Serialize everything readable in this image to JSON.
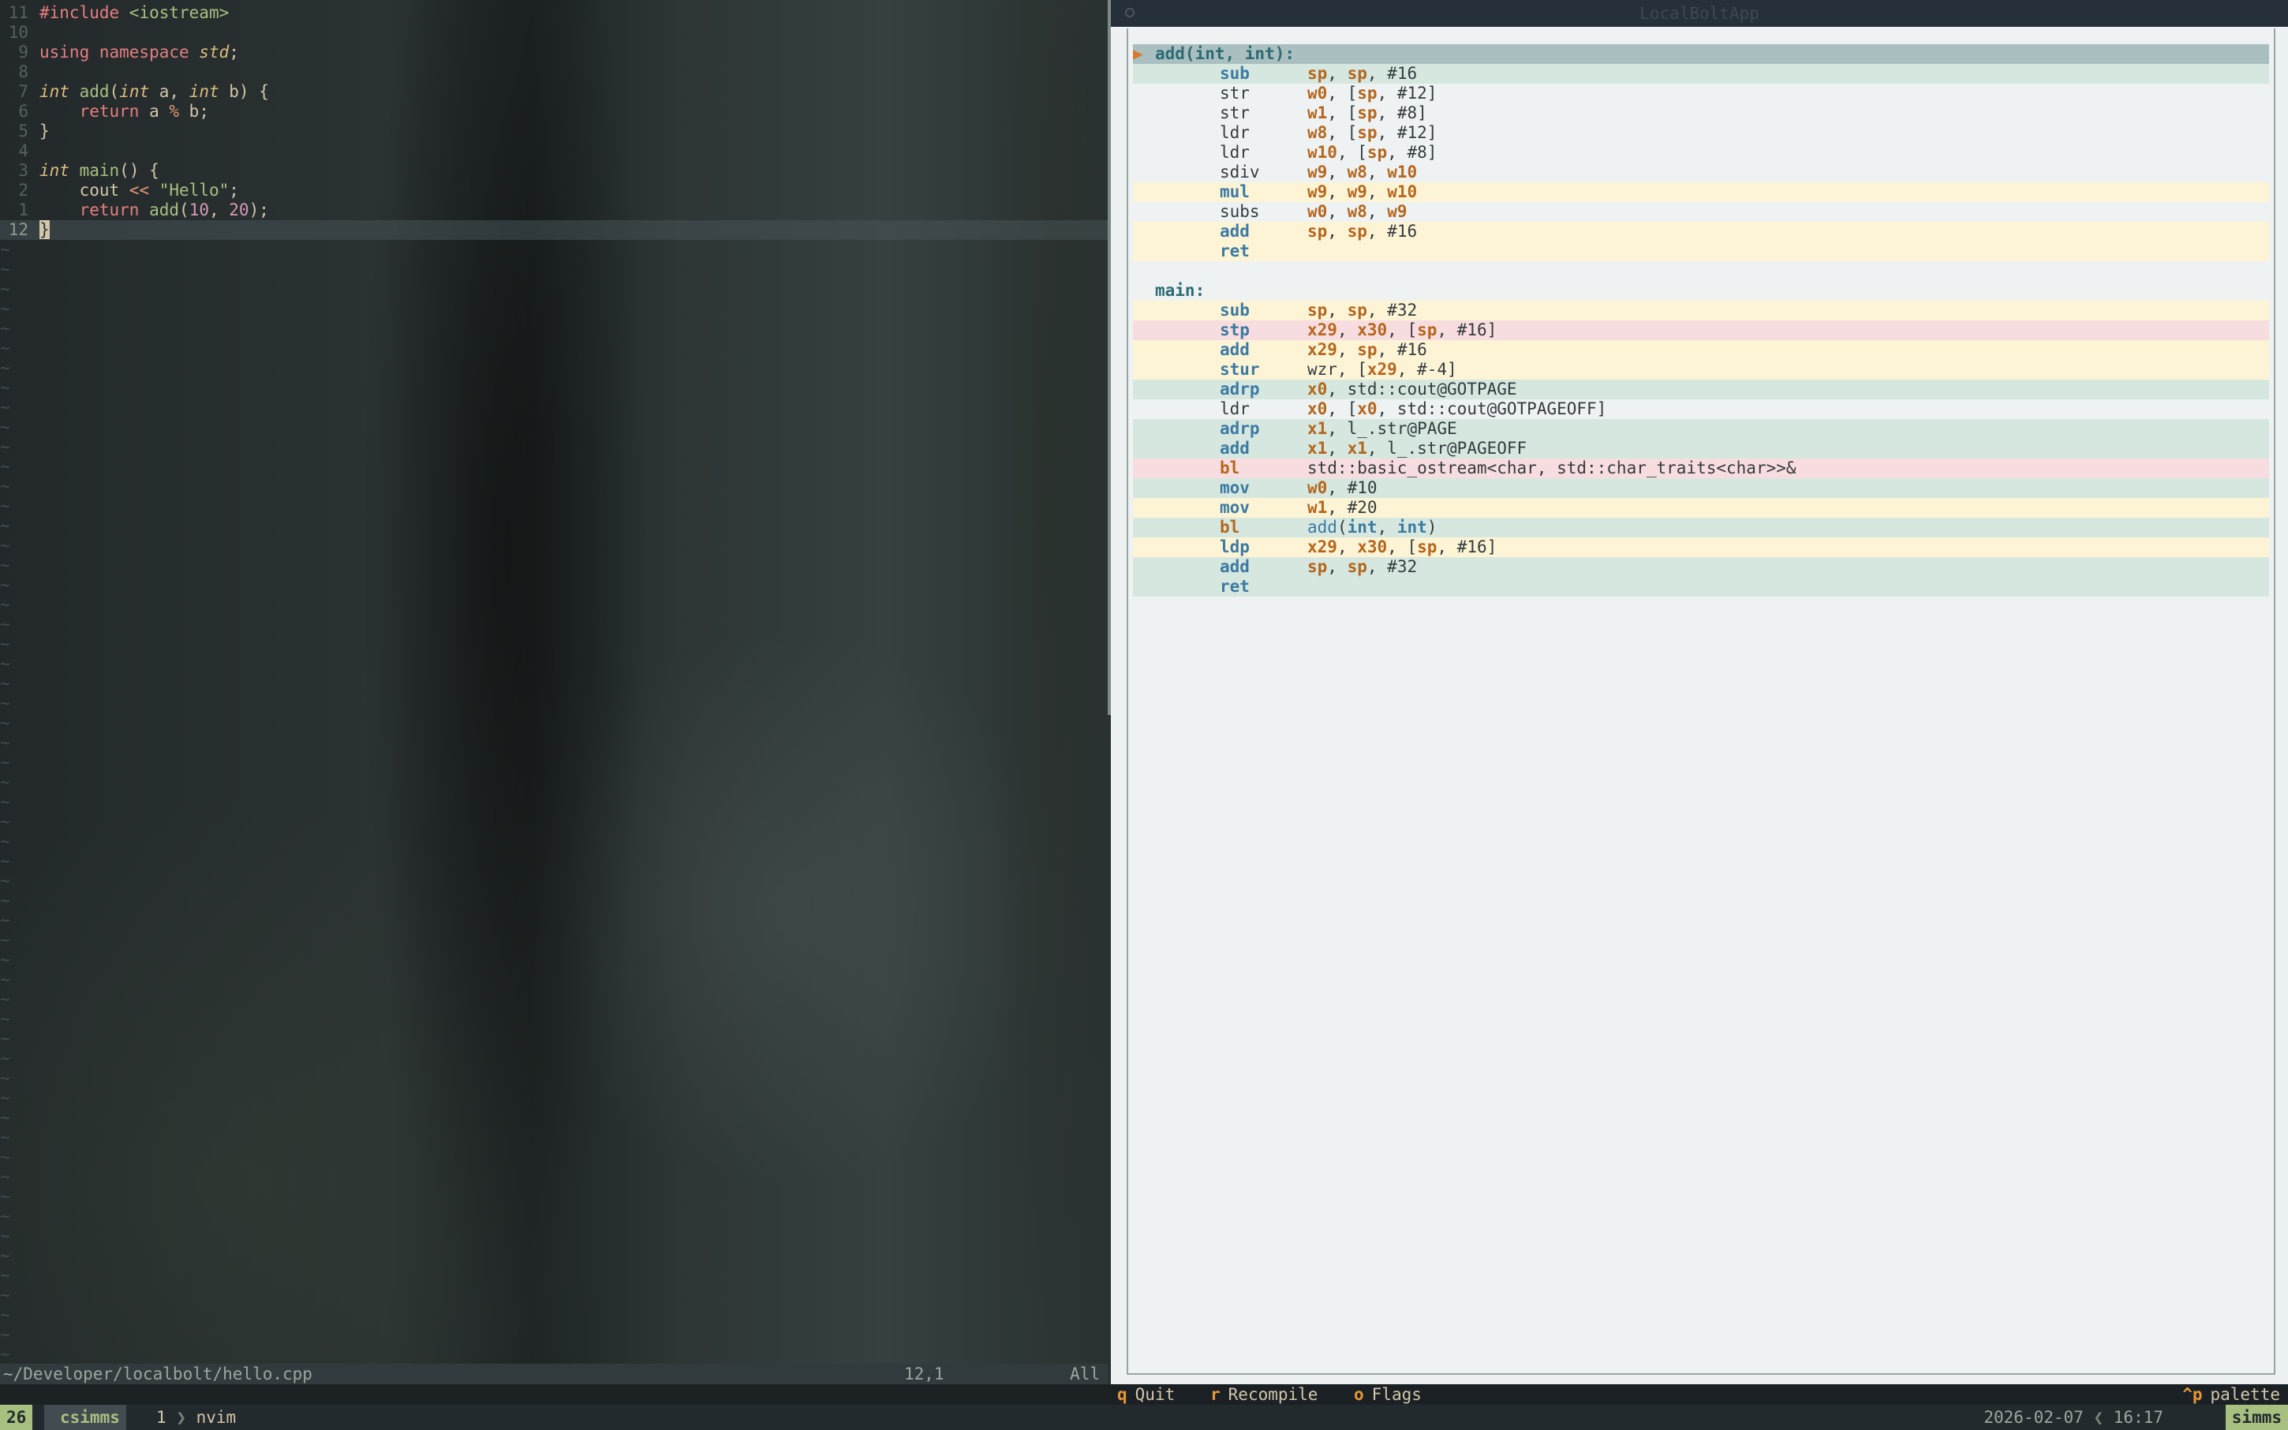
{
  "editor": {
    "lines": [
      {
        "num": "11",
        "tokens": [
          {
            "t": "#include ",
            "c": "pp"
          },
          {
            "t": "<iostream>",
            "c": "inc"
          }
        ]
      },
      {
        "num": "10",
        "tokens": []
      },
      {
        "num": "9",
        "tokens": [
          {
            "t": "using ",
            "c": "kw"
          },
          {
            "t": "namespace ",
            "c": "kw"
          },
          {
            "t": "std",
            "c": "ns"
          },
          {
            "t": ";",
            "c": "id"
          }
        ]
      },
      {
        "num": "8",
        "tokens": []
      },
      {
        "num": "7",
        "tokens": [
          {
            "t": "int",
            "c": "ty"
          },
          {
            "t": " ",
            "c": "id"
          },
          {
            "t": "add",
            "c": "fn"
          },
          {
            "t": "(",
            "c": "id"
          },
          {
            "t": "int",
            "c": "ty"
          },
          {
            "t": " a, ",
            "c": "id"
          },
          {
            "t": "int",
            "c": "ty"
          },
          {
            "t": " b) {",
            "c": "id"
          }
        ]
      },
      {
        "num": "6",
        "tokens": [
          {
            "t": "    ",
            "c": "id"
          },
          {
            "t": "return",
            "c": "kw"
          },
          {
            "t": " a ",
            "c": "id"
          },
          {
            "t": "%",
            "c": "op"
          },
          {
            "t": " b;",
            "c": "id"
          }
        ]
      },
      {
        "num": "5",
        "tokens": [
          {
            "t": "}",
            "c": "id"
          }
        ]
      },
      {
        "num": "4",
        "tokens": []
      },
      {
        "num": "3",
        "tokens": [
          {
            "t": "int",
            "c": "ty"
          },
          {
            "t": " ",
            "c": "id"
          },
          {
            "t": "main",
            "c": "fn"
          },
          {
            "t": "() {",
            "c": "id"
          }
        ]
      },
      {
        "num": "2",
        "tokens": [
          {
            "t": "    cout ",
            "c": "id"
          },
          {
            "t": "<<",
            "c": "op"
          },
          {
            "t": " ",
            "c": "id"
          },
          {
            "t": "\"Hello\"",
            "c": "st"
          },
          {
            "t": ";",
            "c": "id"
          }
        ]
      },
      {
        "num": "1",
        "tokens": [
          {
            "t": "    ",
            "c": "id"
          },
          {
            "t": "return",
            "c": "kw"
          },
          {
            "t": " ",
            "c": "id"
          },
          {
            "t": "add",
            "c": "fn"
          },
          {
            "t": "(",
            "c": "id"
          },
          {
            "t": "10",
            "c": "num"
          },
          {
            "t": ", ",
            "c": "id"
          },
          {
            "t": "20",
            "c": "num"
          },
          {
            "t": ");",
            "c": "id"
          }
        ]
      },
      {
        "num": "12",
        "current": true,
        "tokens": [
          {
            "t": "}",
            "c": "cursor"
          }
        ]
      }
    ],
    "tilde_count": 62,
    "tilde_char": "~"
  },
  "nvim_status": {
    "path": "~/Developer/localbolt/hello.cpp",
    "position": "12,1",
    "percent": "All"
  },
  "app": {
    "title": "LocalBoltApp",
    "asm_lines": [
      {
        "kind": "head",
        "label": "add(int, int):",
        "arrow": "▶",
        "color": "head"
      },
      {
        "m": "sub",
        "k": true,
        "ops": [
          [
            "sp",
            "r"
          ],
          [
            ", ",
            "p"
          ],
          [
            "sp",
            "r"
          ],
          [
            ", #16",
            "n"
          ]
        ],
        "color": "green"
      },
      {
        "m": "str",
        "k": false,
        "ops": [
          [
            "w0",
            "r"
          ],
          [
            ", [",
            "p"
          ],
          [
            "sp",
            "r"
          ],
          [
            ", #12]",
            "n"
          ]
        ]
      },
      {
        "m": "str",
        "k": false,
        "ops": [
          [
            "w1",
            "r"
          ],
          [
            ", [",
            "p"
          ],
          [
            "sp",
            "r"
          ],
          [
            ", #8]",
            "n"
          ]
        ]
      },
      {
        "m": "ldr",
        "k": false,
        "ops": [
          [
            "w8",
            "r"
          ],
          [
            ", [",
            "p"
          ],
          [
            "sp",
            "r"
          ],
          [
            ", #12]",
            "n"
          ]
        ]
      },
      {
        "m": "ldr",
        "k": false,
        "ops": [
          [
            "w10",
            "r"
          ],
          [
            ", [",
            "p"
          ],
          [
            "sp",
            "r"
          ],
          [
            ", #8]",
            "n"
          ]
        ]
      },
      {
        "m": "sdiv",
        "k": false,
        "ops": [
          [
            "w9",
            "r"
          ],
          [
            ", ",
            "p"
          ],
          [
            "w8",
            "r"
          ],
          [
            ", ",
            "p"
          ],
          [
            "w10",
            "r"
          ]
        ]
      },
      {
        "m": "mul",
        "k": true,
        "ops": [
          [
            "w9",
            "r"
          ],
          [
            ", ",
            "p"
          ],
          [
            "w9",
            "r"
          ],
          [
            ", ",
            "p"
          ],
          [
            "w10",
            "r"
          ]
        ],
        "color": "yellow"
      },
      {
        "m": "subs",
        "k": false,
        "ops": [
          [
            "w0",
            "r"
          ],
          [
            ", ",
            "p"
          ],
          [
            "w8",
            "r"
          ],
          [
            ", ",
            "p"
          ],
          [
            "w9",
            "r"
          ]
        ]
      },
      {
        "m": "add",
        "k": true,
        "ops": [
          [
            "sp",
            "r"
          ],
          [
            ", ",
            "p"
          ],
          [
            "sp",
            "r"
          ],
          [
            ", #16",
            "n"
          ]
        ],
        "color": "yellow"
      },
      {
        "m": "ret",
        "k": true,
        "ops": [],
        "color": "yellow"
      },
      {
        "kind": "blank"
      },
      {
        "kind": "label",
        "label": "main:"
      },
      {
        "m": "sub",
        "k": true,
        "ops": [
          [
            "sp",
            "r"
          ],
          [
            ", ",
            "p"
          ],
          [
            "sp",
            "r"
          ],
          [
            ", #32",
            "n"
          ]
        ],
        "color": "yellow"
      },
      {
        "m": "stp",
        "k": true,
        "ops": [
          [
            "x29",
            "r"
          ],
          [
            ", ",
            "p"
          ],
          [
            "x30",
            "r"
          ],
          [
            ", [",
            "p"
          ],
          [
            "sp",
            "r"
          ],
          [
            ", #16]",
            "n"
          ]
        ],
        "color": "red"
      },
      {
        "m": "add",
        "k": true,
        "ops": [
          [
            "x29",
            "r"
          ],
          [
            ", ",
            "p"
          ],
          [
            "sp",
            "r"
          ],
          [
            ", #16",
            "n"
          ]
        ],
        "color": "yellow"
      },
      {
        "m": "stur",
        "k": true,
        "ops": [
          [
            "wzr, [",
            "p"
          ],
          [
            "x29",
            "r"
          ],
          [
            ", #-4]",
            "n"
          ]
        ],
        "color": "yellow"
      },
      {
        "m": "adrp",
        "k": true,
        "ops": [
          [
            "x0",
            "r"
          ],
          [
            ", std::cout@GOTPAGE",
            "s"
          ]
        ],
        "color": "green"
      },
      {
        "m": "ldr",
        "k": false,
        "ops": [
          [
            "x0",
            "r"
          ],
          [
            ", [",
            "p"
          ],
          [
            "x0",
            "r"
          ],
          [
            ", std::cout@GOTPAGEOFF]",
            "s"
          ]
        ]
      },
      {
        "m": "adrp",
        "k": true,
        "ops": [
          [
            "x1",
            "r"
          ],
          [
            ", l_.str@PAGE",
            "s"
          ]
        ],
        "color": "green"
      },
      {
        "m": "add",
        "k": true,
        "ops": [
          [
            "x1",
            "r"
          ],
          [
            ", ",
            "p"
          ],
          [
            "x1",
            "r"
          ],
          [
            ", l_.str@PAGEOFF",
            "s"
          ]
        ],
        "color": "green"
      },
      {
        "m": "bl",
        "k": true,
        "ops": [
          [
            "std::basic_ostream<char, std::char_traits<char>>&",
            "s"
          ]
        ],
        "color": "red",
        "mred": true
      },
      {
        "m": "mov",
        "k": true,
        "ops": [
          [
            "w0",
            "r"
          ],
          [
            ", #10",
            "n"
          ]
        ],
        "color": "green"
      },
      {
        "m": "mov",
        "k": true,
        "ops": [
          [
            "w1",
            "r"
          ],
          [
            ", #20",
            "n"
          ]
        ],
        "color": "yellow"
      },
      {
        "m": "bl",
        "k": true,
        "ops": [
          [
            "add",
            "f"
          ],
          [
            "(",
            "p"
          ],
          [
            "int",
            "fk"
          ],
          [
            ", ",
            "p"
          ],
          [
            "int",
            "fk"
          ],
          [
            ")",
            "p"
          ]
        ],
        "color": "green",
        "mred": true
      },
      {
        "m": "ldp",
        "k": true,
        "ops": [
          [
            "x29",
            "r"
          ],
          [
            ", ",
            "p"
          ],
          [
            "x30",
            "r"
          ],
          [
            ", [",
            "p"
          ],
          [
            "sp",
            "r"
          ],
          [
            ", #16]",
            "n"
          ]
        ],
        "color": "yellow"
      },
      {
        "m": "add",
        "k": true,
        "ops": [
          [
            "sp",
            "r"
          ],
          [
            ", ",
            "p"
          ],
          [
            "sp",
            "r"
          ],
          [
            ", #32",
            "n"
          ]
        ],
        "color": "green"
      },
      {
        "m": "ret",
        "k": true,
        "ops": [],
        "color": "green"
      }
    ],
    "footer": {
      "quit_key": "q",
      "quit_label": "Quit",
      "recompile_key": "r",
      "recompile_label": "Recompile",
      "flags_key": "o",
      "flags_label": "Flags",
      "palette_key": "^p",
      "palette_label": "palette"
    }
  },
  "tmux": {
    "session_num": "26",
    "session_name": "csimms",
    "window_index": "1",
    "window_sep": "❯",
    "window_name": "nvim",
    "date": "2026-02-07",
    "date_sep": "❮",
    "time": "16:17",
    "host": "simms"
  },
  "colors": {
    "accent": "#a7c080",
    "key": "#e69833",
    "register": "#b5661c",
    "mnemonic": "#3c7aa3"
  }
}
